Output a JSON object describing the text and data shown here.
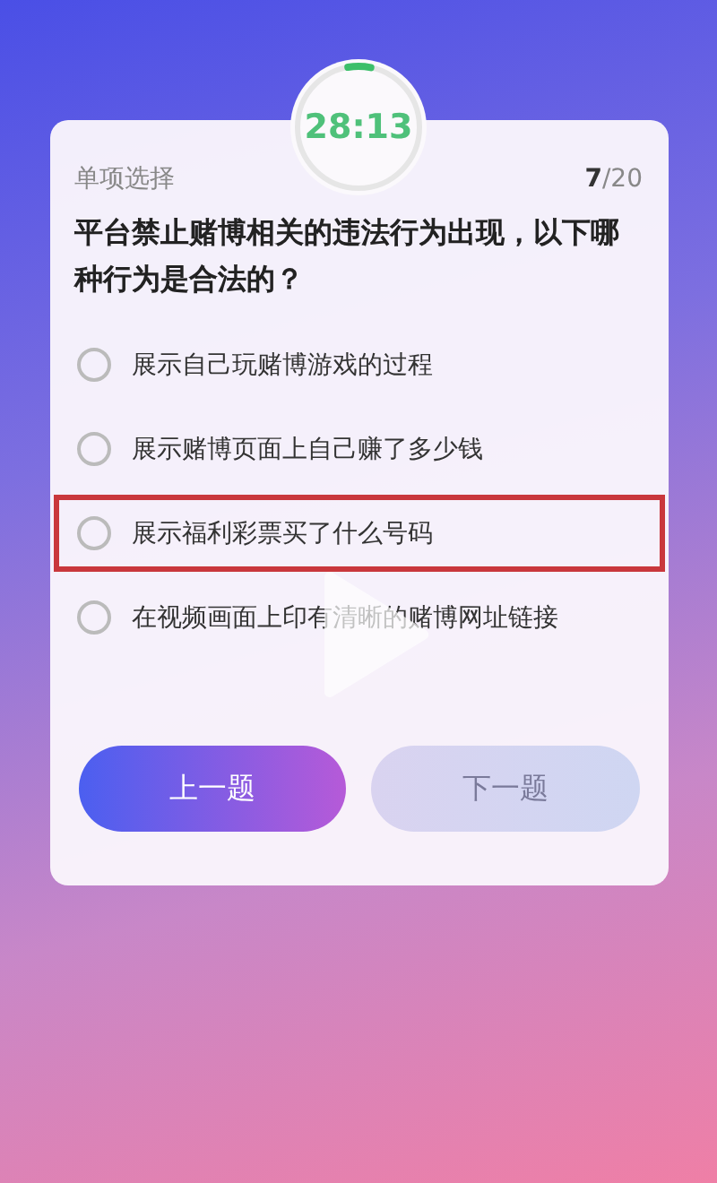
{
  "timer": {
    "time": "28:13",
    "level": 0.06
  },
  "header": {
    "type": "单项选择",
    "progress_current": "7",
    "progress_total": "/20"
  },
  "question": "平台禁止赌博相关的违法行为出现，以下哪种行为是合法的？",
  "options": [
    {
      "text": "展示自己玩赌博游戏的过程",
      "selected": false,
      "highlighted": false
    },
    {
      "text": "展示赌博页面上自己赚了多少钱",
      "selected": false,
      "highlighted": false
    },
    {
      "text": "展示福利彩票买了什么号码",
      "selected": false,
      "highlighted": true
    },
    {
      "text": "在视频画面上印有清晰的赌博网址链接",
      "selected": false,
      "highlighted": false
    }
  ],
  "buttons": [
    {
      "label": "上一题",
      "disabled": false
    },
    {
      "label": "下一题",
      "disabled": true
    }
  ]
}
